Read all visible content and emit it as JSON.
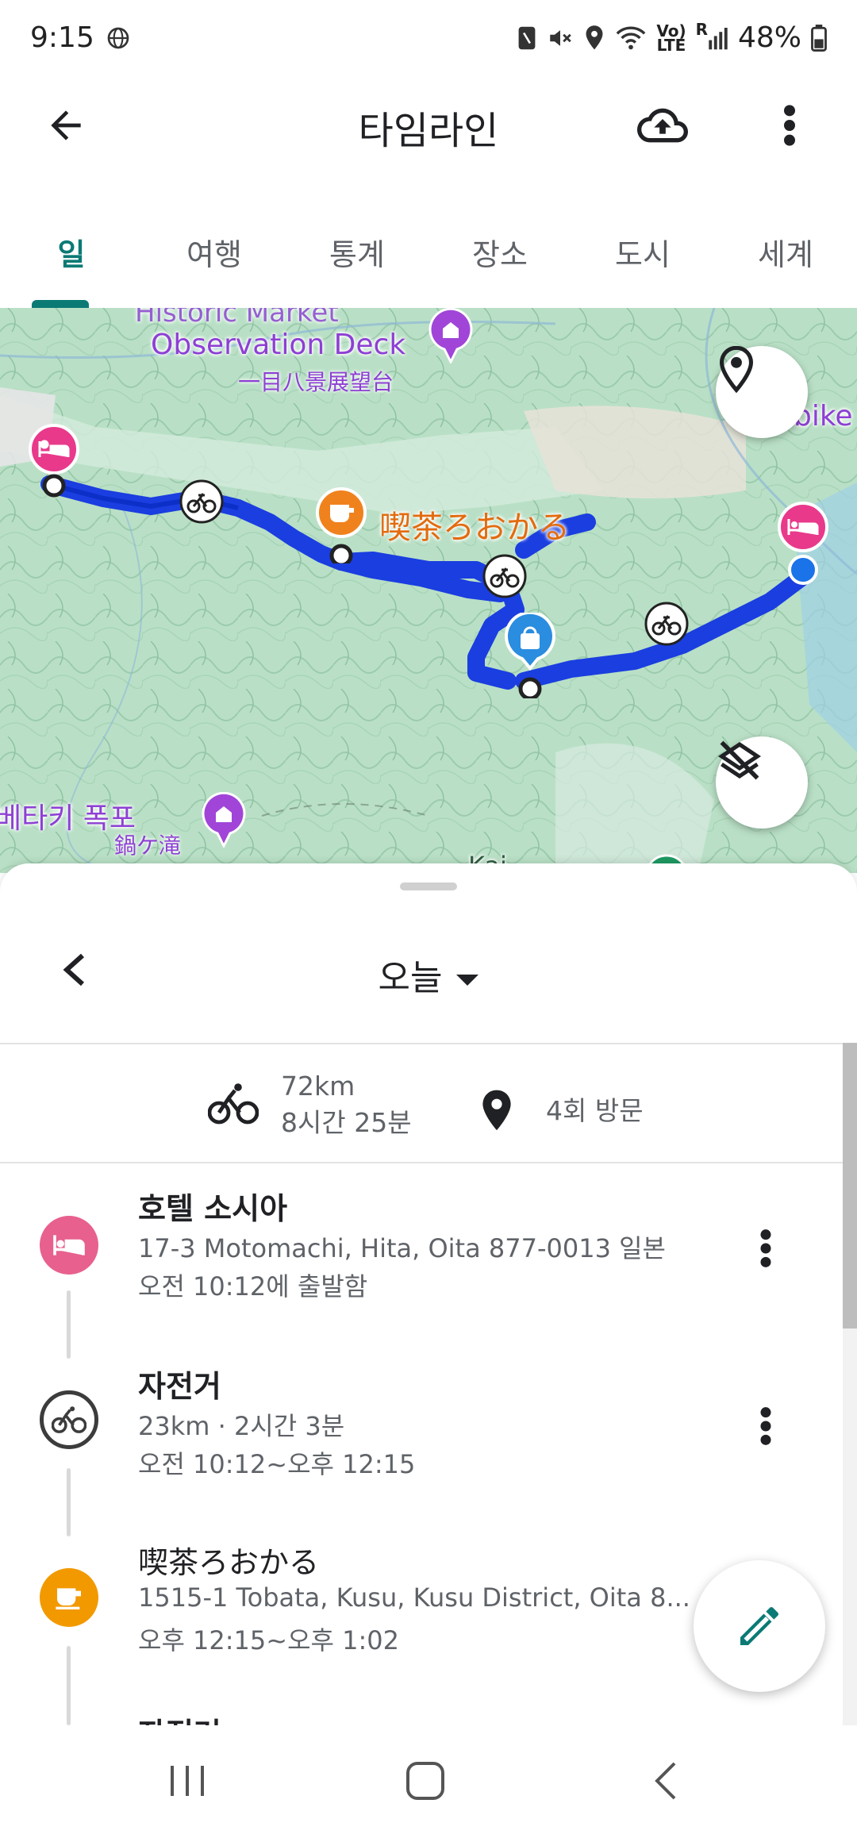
{
  "status_bar": {
    "time": "9:15",
    "battery": "48%",
    "icons": [
      "globe-icon",
      "nfc-icon",
      "mute-icon",
      "location-icon",
      "wifi-icon",
      "volte-icon",
      "signal-icon",
      "battery-icon"
    ],
    "volte_line1": "Vo)",
    "volte_line2": "LTE",
    "roaming": "R"
  },
  "app_bar": {
    "title": "타임라인",
    "back_icon": "arrow-back-icon",
    "cloud_icon": "cloud-upload-icon",
    "more_icon": "more-vert-icon"
  },
  "tabs": [
    {
      "label": "일",
      "active": true
    },
    {
      "label": "여행",
      "active": false
    },
    {
      "label": "통계",
      "active": false
    },
    {
      "label": "장소",
      "active": false
    },
    {
      "label": "도시",
      "active": false
    },
    {
      "label": "세계",
      "active": false
    }
  ],
  "map": {
    "labels": {
      "observation_deck": "Observation Deck",
      "observation_deck_sub": "一目八景展望台",
      "cafe": "喫茶ろおかる",
      "waterfall": "베타키 폭포",
      "waterfall_sub": "鍋ケ滝",
      "bike_edge": "bike",
      "partial_top": "Historic Market",
      "partial_bottom": "Kai"
    },
    "route_color": "#1a3ee0",
    "lodging_color": "#e8398b",
    "cafe_color": "#f0821e",
    "shop_color": "#2a8de0",
    "purple_poi_color": "#a145d8"
  },
  "sheet": {
    "date_label": "오늘",
    "summary": {
      "distance": "72km",
      "duration": "8시간 25분",
      "visits": "4회 방문"
    },
    "items": [
      {
        "type": "lodging",
        "icon": "hotel-bed-icon",
        "title": "호텔 소시아",
        "line1": "17-3 Motomachi, Hita, Oita 877-0013 일본",
        "line2": "오전 10:12에 출발함",
        "color": "#e7608e"
      },
      {
        "type": "activity",
        "icon": "bicycle-icon",
        "title": "자전거",
        "line1": "23km · 2시간 3분",
        "line2": "오전 10:12~오후 12:15",
        "color": "#3c3c3c"
      },
      {
        "type": "cafe",
        "icon": "coffee-cup-icon",
        "title": "喫茶ろおかる",
        "line1": "1515-1 Tobata, Kusu, Kusu District, Oita 8...",
        "line2": "오후 12:15~오후 1:02",
        "color": "#f29900"
      },
      {
        "type": "activity",
        "title": "자전거"
      }
    ]
  },
  "accent_color": "#0b7a75"
}
